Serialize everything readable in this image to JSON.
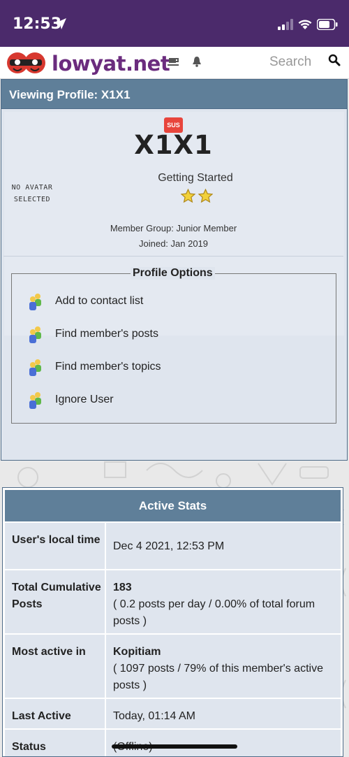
{
  "status_bar": {
    "time": "12:53"
  },
  "nav": {
    "logo_text": "lowyat.net",
    "search_placeholder": "Search"
  },
  "profile": {
    "header_title": "Viewing Profile: X1X1",
    "badge": "SUS",
    "username": "X1X1",
    "avatar_placeholder_line1": "NO AVATAR",
    "avatar_placeholder_line2": "SELECTED",
    "rank": "Getting Started",
    "stars": 2,
    "member_group": "Member Group: Junior Member",
    "joined": "Joined: Jan 2019"
  },
  "profile_options": {
    "legend": "Profile Options",
    "items": [
      {
        "label": "Add to contact list",
        "icon": "members-icon"
      },
      {
        "label": "Find member's posts",
        "icon": "members-icon"
      },
      {
        "label": "Find member's topics",
        "icon": "members-icon"
      },
      {
        "label": "Ignore User",
        "icon": "members-icon"
      }
    ]
  },
  "active_stats": {
    "title": "Active Stats",
    "rows": [
      {
        "key": "User's local time",
        "value_bold": "",
        "value": "Dec 4 2021, 12:53 PM"
      },
      {
        "key": "Total Cumulative Posts",
        "value_bold": "183",
        "value": "( 0.2 posts per day / 0.00% of total forum posts )"
      },
      {
        "key": "Most active in",
        "value_bold": "Kopitiam",
        "value": "( 1097 posts / 79% of this member's active posts )"
      },
      {
        "key": "Last Active",
        "value_bold": "",
        "value": "Today, 01:14 AM"
      },
      {
        "key": "Status",
        "value_bold": "",
        "value": "(Offline)"
      }
    ]
  },
  "colors": {
    "status_bar": "#4b2a6b",
    "logo": "#6b2c7e",
    "panel_header": "#5f7f99",
    "panel_bg": "#dfe5ee",
    "badge": "#e8453c",
    "star": "#f2d13a"
  }
}
